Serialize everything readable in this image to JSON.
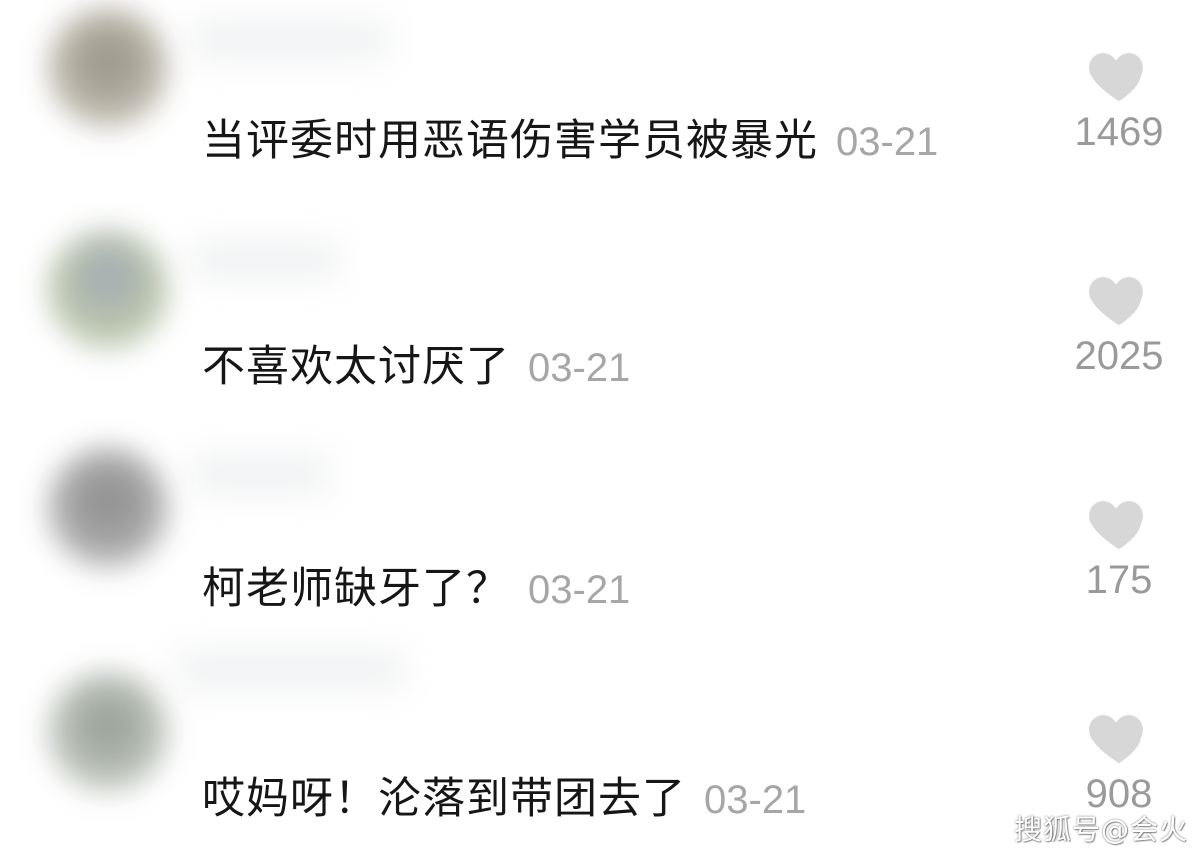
{
  "comments": [
    {
      "text": "当评委时用恶语伤害学员被暴光",
      "date": "03-21",
      "likes": "1469",
      "avatar_colors": [
        "#8f8c80",
        "#b7b2a4",
        "#d8d6cf"
      ]
    },
    {
      "text": "不喜欢太讨厌了",
      "date": "03-21",
      "likes": "2025",
      "avatar_colors": [
        "#9aa6b2",
        "#b9c3a6",
        "#dfe6ee"
      ]
    },
    {
      "text": "柯老师缺牙了？",
      "date": "03-21",
      "likes": "175",
      "avatar_colors": [
        "#858585",
        "#a7a7a7",
        "#d9d9d9"
      ]
    },
    {
      "text": "哎妈呀！沦落到带团去了",
      "date": "03-21",
      "likes": "908",
      "avatar_colors": [
        "#8f978e",
        "#b7bdb4",
        "#e0e6e0"
      ]
    }
  ],
  "icons": {
    "like": "heart-icon"
  },
  "colors": {
    "comment_text": "#161616",
    "date_text": "#a6a6a6",
    "like_count": "#9a9a9a",
    "heart_fill": "#d7d7d7"
  },
  "watermark": "搜狐号@会火"
}
